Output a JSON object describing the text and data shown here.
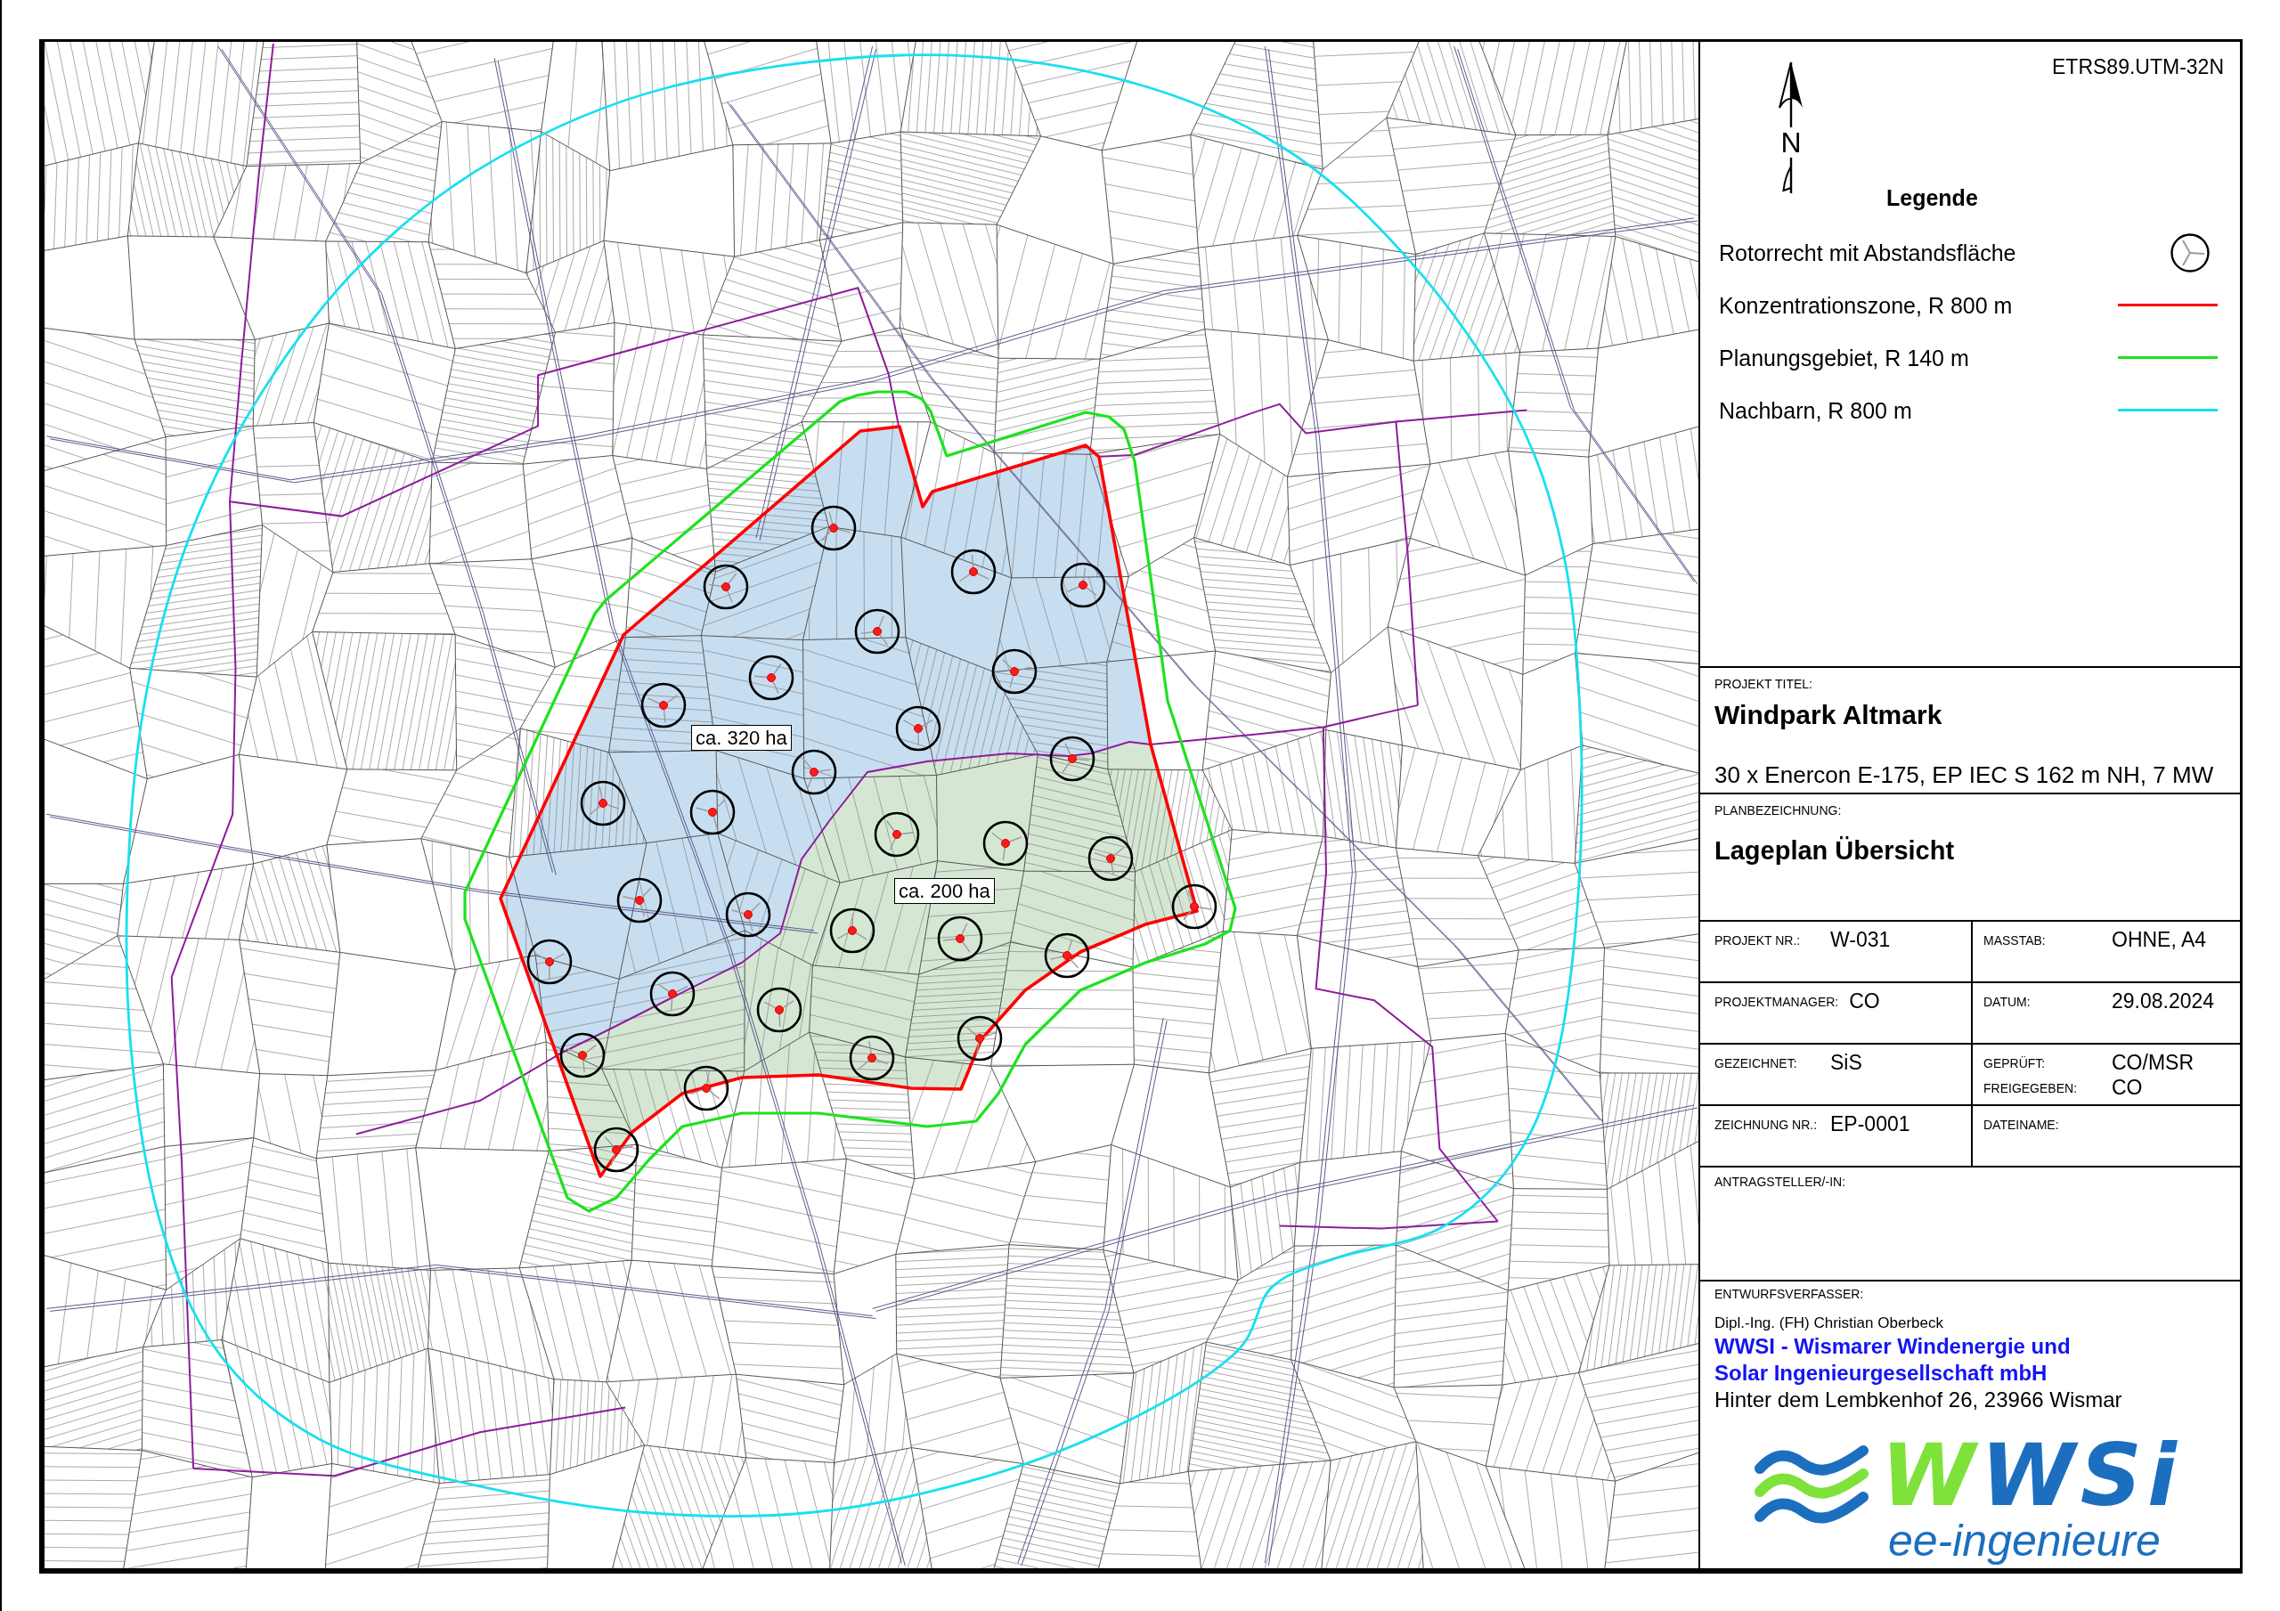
{
  "map": {
    "area_labels": [
      "ca. 320 ha",
      "ca. 200 ha"
    ]
  },
  "title_block": {
    "crs": "ETRS89.UTM-32N",
    "north_arrow": {
      "label": "N"
    },
    "legend": {
      "title": "Legende",
      "items": [
        {
          "kind": "symbol",
          "label": "Rotorrecht mit Abstandsfläche"
        },
        {
          "kind": "line",
          "label": "Konzentrationszone, R 800 m",
          "color": "#ff0000"
        },
        {
          "kind": "line",
          "label": "Planungsgebiet, R 140 m",
          "color": "#1de21d"
        },
        {
          "kind": "line",
          "label": "Nachbarn, R 800 m",
          "color": "#18e0ef"
        }
      ]
    },
    "project_title": {
      "label": "PROJEKT TITEL:",
      "title": "Windpark Altmark",
      "subtitle": "30 x Enercon E-175, EP IEC S 162 m NH, 7 MW"
    },
    "plan_name": {
      "label": "PLANBEZEICHNUNG:",
      "title": "Lageplan Übersicht"
    },
    "fields": [
      [
        {
          "entries": [
            {
              "label": "PROJEKT NR.:",
              "value": "W-031"
            }
          ]
        },
        {
          "entries": [
            {
              "label": "MASSTAB:",
              "value": "OHNE, A4"
            }
          ]
        }
      ],
      [
        {
          "entries": [
            {
              "label": "PROJEKTMANAGER:",
              "value": "CO"
            }
          ]
        },
        {
          "entries": [
            {
              "label": "DATUM:",
              "value": "29.08.2024"
            }
          ]
        }
      ],
      [
        {
          "entries": [
            {
              "label": "GEZEICHNET:",
              "value": "SiS"
            }
          ]
        },
        {
          "entries": [
            {
              "label": "GEPRÜFT:",
              "value": "CO/MSR"
            },
            {
              "label": "FREIGEGEBEN:",
              "value": "CO"
            }
          ]
        }
      ],
      [
        {
          "entries": [
            {
              "label": "ZEICHNUNG NR.:",
              "value": "EP-0001"
            }
          ]
        },
        {
          "entries": [
            {
              "label": "DATEINAME:"
            }
          ]
        }
      ]
    ],
    "applicant": {
      "label": "ANTRAGSTELLER/-IN:"
    },
    "designer": {
      "label": "ENTWURFSVERFASSER:",
      "name": "Dipl.-Ing. (FH) Christian Oberbeck",
      "company": "WWSI - Wismarer Windenergie und Solar Ingenieurgesellschaft mbH",
      "address": "Hinter dem Lembkenhof 26, 23966 Wismar"
    },
    "logo": {
      "wordmark": "WWSi",
      "tagline": "ee-ingenieure"
    }
  }
}
